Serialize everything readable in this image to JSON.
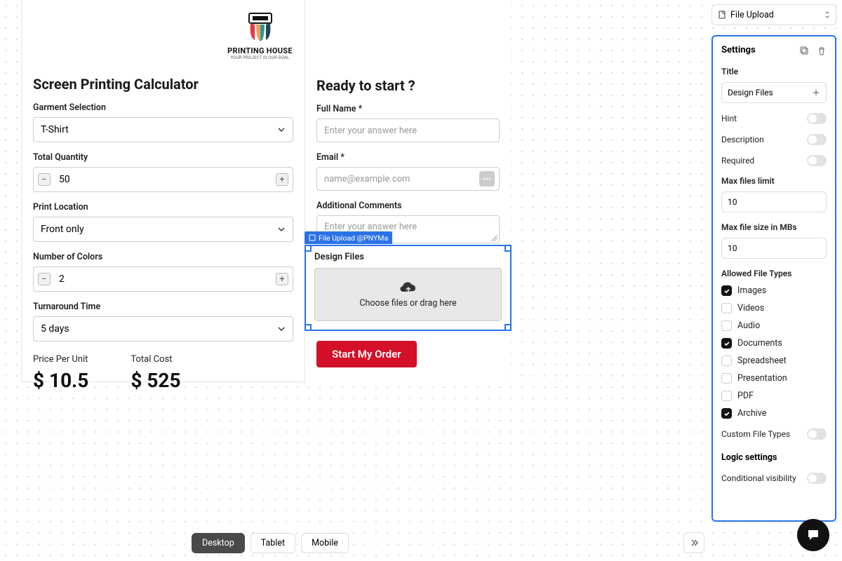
{
  "logo": {
    "title": "PRINTING HOUSE",
    "sub": "YOUR PROJECT IS OUR GOAL"
  },
  "calc": {
    "heading": "Screen Printing Calculator",
    "garment_label": "Garment Selection",
    "garment_value": "T-Shirt",
    "qty_label": "Total Quantity",
    "qty_value": "50",
    "loc_label": "Print Location",
    "loc_value": "Front only",
    "colors_label": "Number of Colors",
    "colors_value": "2",
    "turn_label": "Turnaround Time",
    "turn_value": "5 days",
    "ppu_label": "Price Per Unit",
    "ppu_value": "$ 10.5",
    "total_label": "Total Cost",
    "total_value": "$ 525"
  },
  "form": {
    "heading": "Ready to start ?",
    "name_label": "Full Name *",
    "name_ph": "Enter your answer here",
    "email_label": "Email *",
    "email_ph": "name@example.com",
    "comments_label": "Additional Comments",
    "comments_ph": "Enter your answer here",
    "file_label": "Design Files",
    "drop_text": "Choose files or drag here",
    "sel_tag": "File Upload @PNYMa",
    "submit": "Start My Order"
  },
  "side_selector": "File Upload",
  "settings": {
    "heading": "Settings",
    "title_l": "Title",
    "title_v": "Design Files",
    "hint_l": "Hint",
    "desc_l": "Description",
    "req_l": "Required",
    "maxf_l": "Max files limit",
    "maxf_v": "10",
    "maxs_l": "Max file size in MBs",
    "maxs_v": "10",
    "types_l": "Allowed File Types",
    "types": [
      {
        "label": "Images",
        "on": true
      },
      {
        "label": "Videos",
        "on": false
      },
      {
        "label": "Audio",
        "on": false
      },
      {
        "label": "Documents",
        "on": true
      },
      {
        "label": "Spreadsheet",
        "on": false
      },
      {
        "label": "Presentation",
        "on": false
      },
      {
        "label": "PDF",
        "on": false
      },
      {
        "label": "Archive",
        "on": true
      }
    ],
    "custom_l": "Custom File Types",
    "logic_l": "Logic settings",
    "cond_l": "Conditional visibility"
  },
  "viewbar": {
    "desktop": "Desktop",
    "tablet": "Tablet",
    "mobile": "Mobile"
  }
}
